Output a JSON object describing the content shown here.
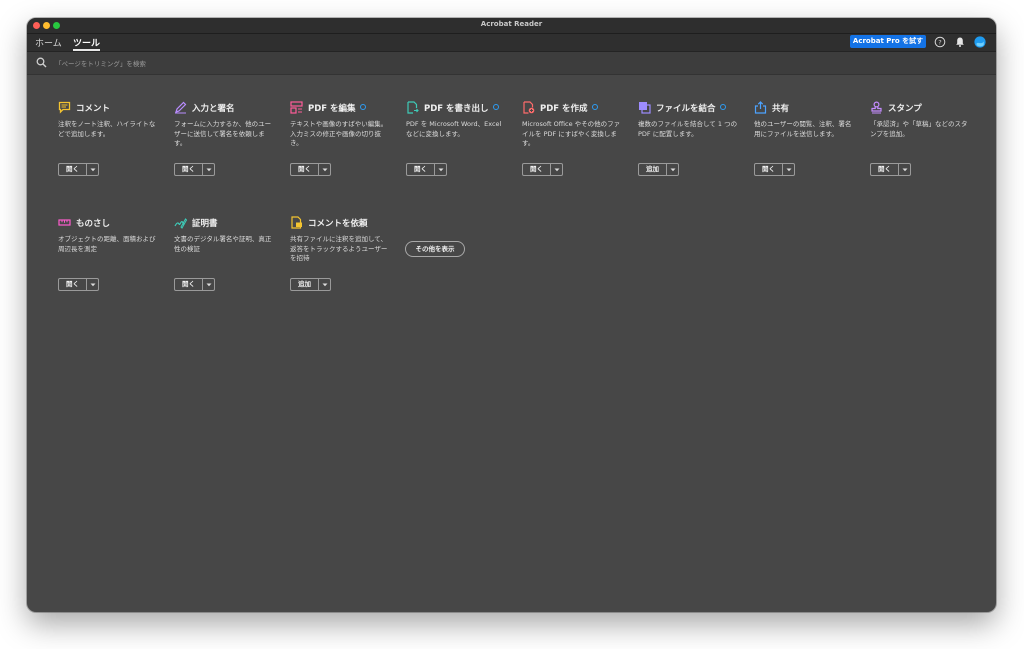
{
  "window": {
    "title": "Acrobat Reader"
  },
  "tabs": [
    {
      "label": "ホーム"
    },
    {
      "label": "ツール"
    }
  ],
  "header": {
    "trial_button": "Acrobat Pro を試す"
  },
  "search": {
    "placeholder": "「ページをトリミング」を検索"
  },
  "tools": [
    {
      "title": "コメント",
      "desc": "注釈をノート注釈、ハイライトなどで追加します。",
      "button": "開く",
      "icon": "comment-icon",
      "color": "#f4c430",
      "badge": false
    },
    {
      "title": "入力と署名",
      "desc": "フォームに入力するか、他のユーザーに送信して署名を依頼します。",
      "button": "開く",
      "icon": "sign-icon",
      "color": "#b98cff",
      "badge": false
    },
    {
      "title": "PDF を編集",
      "desc": "テキストや画像のすばやい編集。入力ミスの修正や画像の切り抜き。",
      "button": "開く",
      "icon": "edit-pdf-icon",
      "color": "#ff5c9a",
      "badge": true
    },
    {
      "title": "PDF を書き出し",
      "desc": "PDF を Microsoft Word、Excel などに変換します。",
      "button": "開く",
      "icon": "export-pdf-icon",
      "color": "#3ecbb8",
      "badge": true
    },
    {
      "title": "PDF を作成",
      "desc": "Microsoft Office やその他のファイルを PDF にすばやく変換します。",
      "button": "開く",
      "icon": "create-pdf-icon",
      "color": "#ff6b6b",
      "badge": true
    },
    {
      "title": "ファイルを結合",
      "desc": "複数のファイルを結合して 1 つの PDF に配置します。",
      "button": "追加",
      "icon": "combine-icon",
      "color": "#9d8cff",
      "badge": true
    },
    {
      "title": "共有",
      "desc": "他のユーザーの閲覧、注釈、署名用にファイルを送信します。",
      "button": "開く",
      "icon": "share-icon",
      "color": "#4da3ff",
      "badge": false
    },
    {
      "title": "スタンプ",
      "desc": "「承認済」や「草稿」などのスタンプを追加。",
      "button": "開く",
      "icon": "stamp-icon",
      "color": "#c58cff",
      "badge": false
    },
    {
      "title": "ものさし",
      "desc": "オブジェクトの距離、面積および周辺長を測定",
      "button": "開く",
      "icon": "ruler-icon",
      "color": "#ff5ccf",
      "badge": false
    },
    {
      "title": "証明書",
      "desc": "文書のデジタル署名や証明、真正性の検証",
      "button": "開く",
      "icon": "certificate-icon",
      "color": "#3ecbb8",
      "badge": false
    },
    {
      "title": "コメントを依頼",
      "desc": "共有ファイルに注釈を追加して、返答をトラックするようユーザーを招待",
      "button": "追加",
      "icon": "request-comment-icon",
      "color": "#f4c430",
      "badge": false
    }
  ],
  "show_more": "その他を表示",
  "colors": {
    "accent": "#1473e6",
    "background": "#474747"
  }
}
